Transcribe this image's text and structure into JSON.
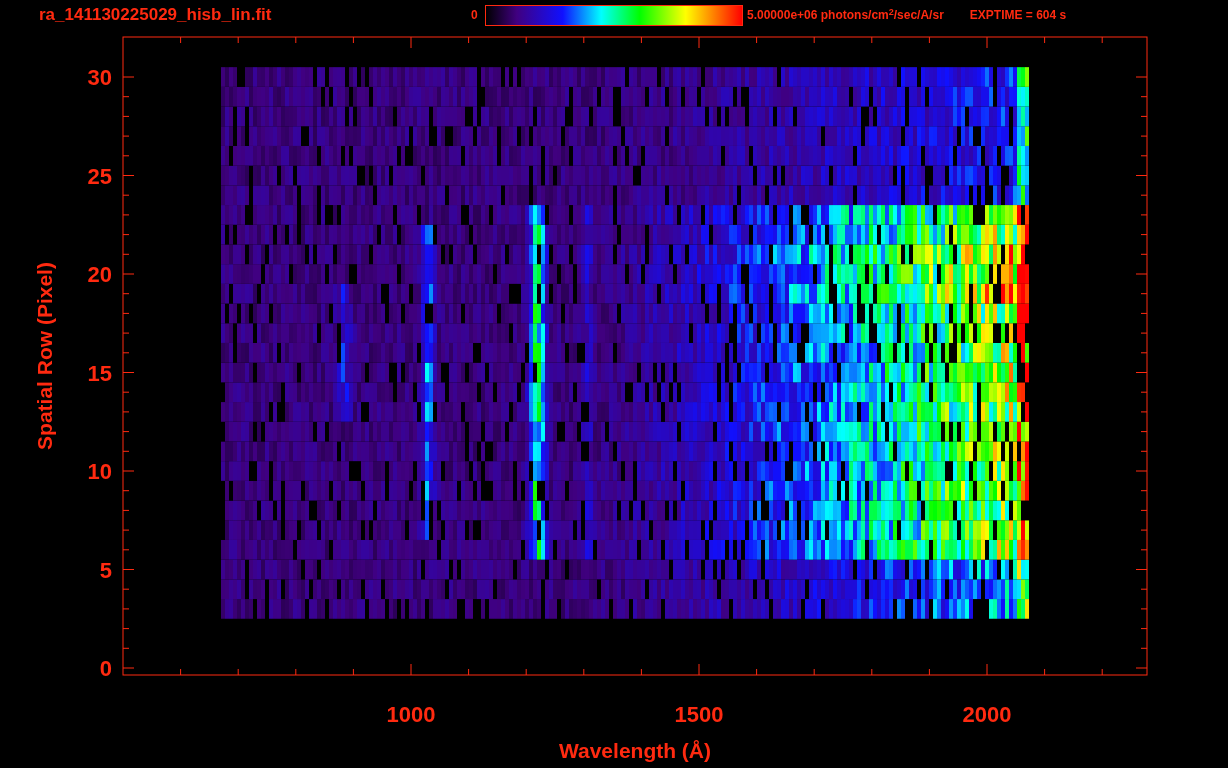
{
  "header": {
    "title": "ra_141130225029_hisb_lin.fit",
    "colorbar": {
      "min_label": "0",
      "max_label": "5.00000e+06 photons/cm$^{2}$/sec/A/sr"
    },
    "exptime": "EXPTIME = 604 s"
  },
  "plot": {
    "ylabel": "Spatial Row (Pixel)",
    "xlabel": "Wavelength (Å)",
    "yticks": [
      "30",
      "25",
      "20",
      "15",
      "10",
      "5",
      "0"
    ],
    "xticks": [
      "1000",
      "1500",
      "2000"
    ]
  }
}
